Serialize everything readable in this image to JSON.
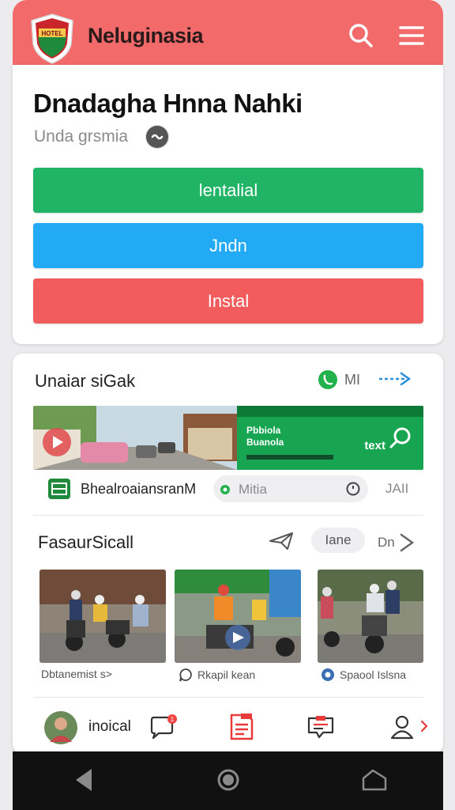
{
  "header": {
    "app_title": "Neluginasia",
    "logo_text": "HOTEL"
  },
  "profile": {
    "title": "Dnadagha Hnna Nahki",
    "subtitle": "Unda grsmia"
  },
  "actions": [
    {
      "label": "lentalial",
      "color": "#21b466"
    },
    {
      "label": "Jndn",
      "color": "#23aaf5"
    },
    {
      "label": "Instal",
      "color": "#f25c5c"
    }
  ],
  "section1": {
    "title": "Unaiar siGak",
    "badge_label": "MI",
    "banner": {
      "line1": "Pbbiola",
      "line2": "Buanola",
      "cta": "text"
    },
    "info": {
      "left_label": "BhealroaiansranM",
      "pill_label": "Mitia",
      "right_label": "JAII"
    }
  },
  "section2": {
    "title": "FasaurSicall",
    "chip_label": "Iane",
    "more_label": "Dn"
  },
  "thumbnails": [
    {
      "caption": "Dbtanemist s>"
    },
    {
      "caption": "Rkapil kean"
    },
    {
      "caption": "Spaool Islsna"
    }
  ],
  "bottom_nav": {
    "profile_label": "inoical",
    "badge_count": "1"
  }
}
